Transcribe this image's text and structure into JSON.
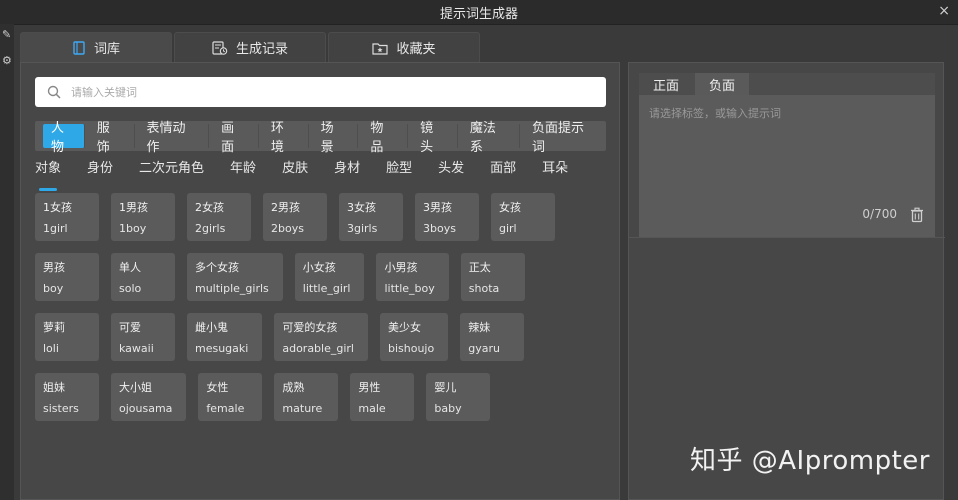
{
  "window": {
    "title": "提示词生成器",
    "close_symbol": "×"
  },
  "main_tabs": [
    {
      "label": "词库",
      "icon": "book-icon"
    },
    {
      "label": "生成记录",
      "icon": "history-icon"
    },
    {
      "label": "收藏夹",
      "icon": "star-folder-icon"
    }
  ],
  "search": {
    "placeholder": "请输入关键词",
    "icon": "search-icon"
  },
  "categories": [
    "人物",
    "服饰",
    "表情动作",
    "画面",
    "环境",
    "场景",
    "物品",
    "镜头",
    "魔法系",
    "负面提示词"
  ],
  "active_category": "人物",
  "subcategories": [
    "对象",
    "身份",
    "二次元角色",
    "年龄",
    "皮肤",
    "身材",
    "脸型",
    "头发",
    "面部",
    "耳朵"
  ],
  "active_subcategory": "对象",
  "tag_rows": [
    [
      {
        "zh": "1女孩",
        "en": "1girl"
      },
      {
        "zh": "1男孩",
        "en": "1boy"
      },
      {
        "zh": "2女孩",
        "en": "2girls"
      },
      {
        "zh": "2男孩",
        "en": "2boys"
      },
      {
        "zh": "3女孩",
        "en": "3girls"
      },
      {
        "zh": "3男孩",
        "en": "3boys"
      },
      {
        "zh": "女孩",
        "en": "girl"
      }
    ],
    [
      {
        "zh": "男孩",
        "en": "boy"
      },
      {
        "zh": "单人",
        "en": "solo"
      },
      {
        "zh": "多个女孩",
        "en": "multiple_girls"
      },
      {
        "zh": "小女孩",
        "en": "little_girl"
      },
      {
        "zh": "小男孩",
        "en": "little_boy"
      },
      {
        "zh": "正太",
        "en": "shota"
      }
    ],
    [
      {
        "zh": "萝莉",
        "en": "loli"
      },
      {
        "zh": "可爱",
        "en": "kawaii"
      },
      {
        "zh": "雌小鬼",
        "en": "mesugaki"
      },
      {
        "zh": "可爱的女孩",
        "en": "adorable_girl"
      },
      {
        "zh": "美少女",
        "en": "bishoujo"
      },
      {
        "zh": "辣妹",
        "en": "gyaru"
      }
    ],
    [
      {
        "zh": "姐妹",
        "en": "sisters"
      },
      {
        "zh": "大小姐",
        "en": "ojousama"
      },
      {
        "zh": "女性",
        "en": "female"
      },
      {
        "zh": "成熟",
        "en": "mature"
      },
      {
        "zh": "男性",
        "en": "male"
      },
      {
        "zh": "婴儿",
        "en": "baby"
      }
    ]
  ],
  "prompt_panel": {
    "tabs": [
      "正面",
      "负面"
    ],
    "active_tab": "正面",
    "placeholder": "请选择标签，或输入提示词",
    "counter": "0/700"
  },
  "watermark": "知乎 @AIprompter",
  "colors": {
    "accent": "#2ea8e6",
    "panel": "#474747",
    "tag": "#5b5b5b"
  }
}
